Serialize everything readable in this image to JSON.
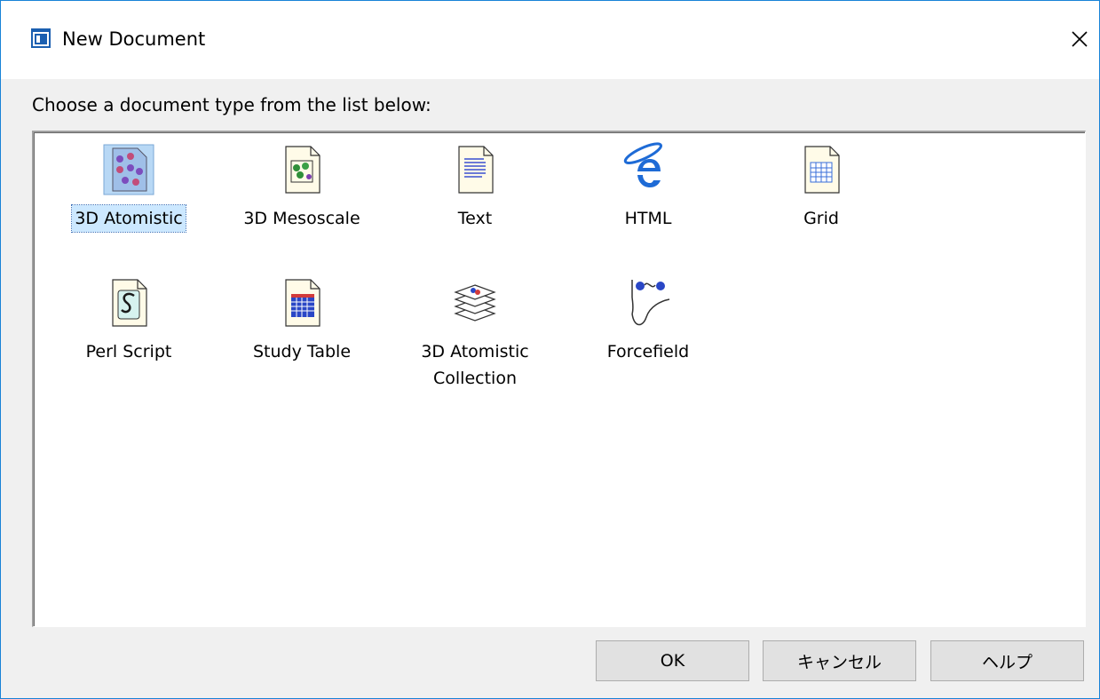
{
  "window": {
    "title": "New Document",
    "close_glyph": "✕"
  },
  "prompt": "Choose a document type from the list below:",
  "items": [
    {
      "label": "3D Atomistic",
      "icon": "atomistic-doc-icon",
      "selected": true
    },
    {
      "label": "3D Mesoscale",
      "icon": "mesoscale-doc-icon",
      "selected": false
    },
    {
      "label": "Text",
      "icon": "text-doc-icon",
      "selected": false
    },
    {
      "label": "HTML",
      "icon": "html-icon",
      "selected": false
    },
    {
      "label": "Grid",
      "icon": "grid-doc-icon",
      "selected": false
    },
    {
      "label": "Perl Script",
      "icon": "perl-script-icon",
      "selected": false
    },
    {
      "label": "Study Table",
      "icon": "study-table-icon",
      "selected": false
    },
    {
      "label": "3D Atomistic\nCollection",
      "icon": "atomistic-collection-icon",
      "selected": false
    },
    {
      "label": "Forcefield",
      "icon": "forcefield-icon",
      "selected": false
    }
  ],
  "buttons": {
    "ok": "OK",
    "cancel": "キャンセル",
    "help": "ヘルプ"
  },
  "colors": {
    "selection_bg": "#cce8ff",
    "window_border": "#1883d7",
    "accent_blue": "#1e6bd6"
  }
}
